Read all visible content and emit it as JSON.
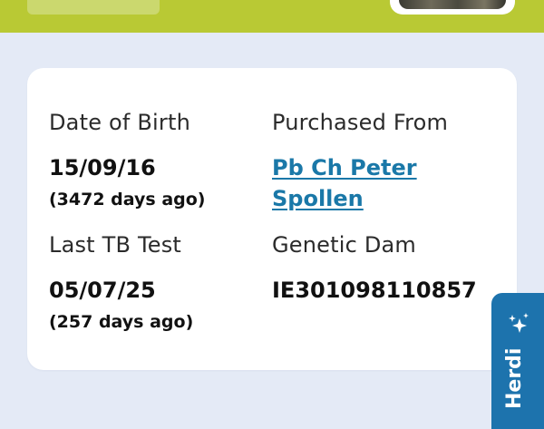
{
  "details": {
    "date_of_birth": {
      "label": "Date of Birth",
      "value": "15/09/16",
      "sub": "(3472 days ago)"
    },
    "purchased_from": {
      "label": "Purchased From",
      "value_line1": "Pb Ch Peter",
      "value_line2": "Spollen"
    },
    "last_tb_test": {
      "label": "Last TB Test",
      "value": "05/07/25",
      "sub": "(257 days ago)"
    },
    "genetic_dam": {
      "label": "Genetic Dam",
      "value": "IE301098110857"
    }
  },
  "assistant": {
    "label": "Herdi",
    "icon": "sparkles-icon"
  },
  "colors": {
    "header": "#b9c934",
    "background": "#e4eaf6",
    "card": "#ffffff",
    "link": "#1a78a8",
    "assistant": "#1d73ad"
  }
}
